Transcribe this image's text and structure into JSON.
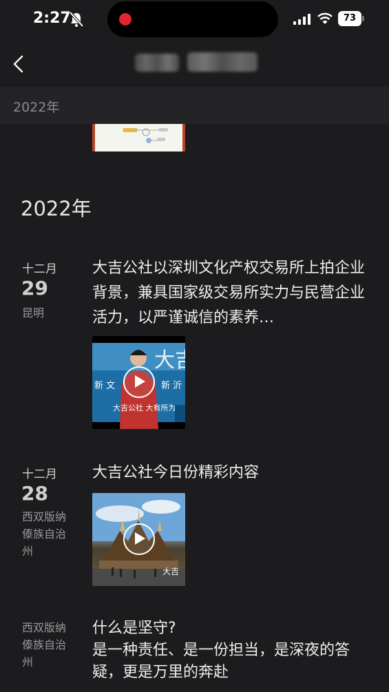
{
  "status_bar": {
    "time": "2:27",
    "battery": "73",
    "icons": [
      "bell-slash-icon",
      "cellular-signal-icon",
      "wifi-icon",
      "battery-icon"
    ],
    "recording_dot_color": "#e0262a"
  },
  "nav": {
    "back_icon": "chevron-left-icon"
  },
  "sticky_year": "2022年",
  "year_heading": "2022年",
  "posts": [
    {
      "month": "十二月",
      "day": "29",
      "location": "昆明",
      "text": "大吉公社以深圳文化产权交易所上拍企业背景，兼具国家级交易所实力与民营企业活力，以严谨诚信的素养…",
      "media": "video"
    },
    {
      "month": "十二月",
      "day": "28",
      "location": "西双版纳傣族自治州",
      "text": "大吉公社今日份精彩内容",
      "media": "video"
    },
    {
      "location": "西双版纳傣族自治州",
      "text": "什么是坚守?\n是一种责任、是一份担当，是深夜的答疑，更是万里的奔赴"
    }
  ]
}
